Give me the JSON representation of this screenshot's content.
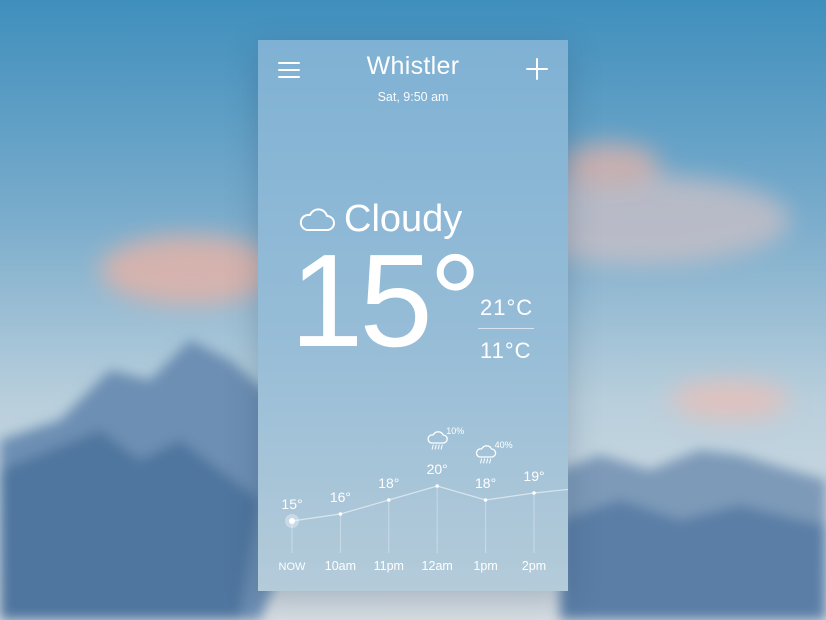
{
  "header": {
    "city": "Whistler",
    "datetime": "Sat, 9:50 am"
  },
  "current": {
    "condition": "Cloudy",
    "condition_icon": "cloud-icon",
    "temperature": "15°",
    "high": "21°C",
    "low": "11°C"
  },
  "forecast": [
    {
      "time": "NOW",
      "temp": "15°",
      "temp_value": 15,
      "precip": ""
    },
    {
      "time": "10am",
      "temp": "16°",
      "temp_value": 16,
      "precip": ""
    },
    {
      "time": "11pm",
      "temp": "18°",
      "temp_value": 18,
      "precip": ""
    },
    {
      "time": "12am",
      "temp": "20°",
      "temp_value": 20,
      "precip": "10%"
    },
    {
      "time": "1pm",
      "temp": "18°",
      "temp_value": 18,
      "precip": "40%"
    },
    {
      "time": "2pm",
      "temp": "19°",
      "temp_value": 19,
      "precip": ""
    }
  ],
  "colors": {
    "card_top": "#7fb1d4",
    "card_bottom": "#aec8d9",
    "text": "#ffffff"
  }
}
